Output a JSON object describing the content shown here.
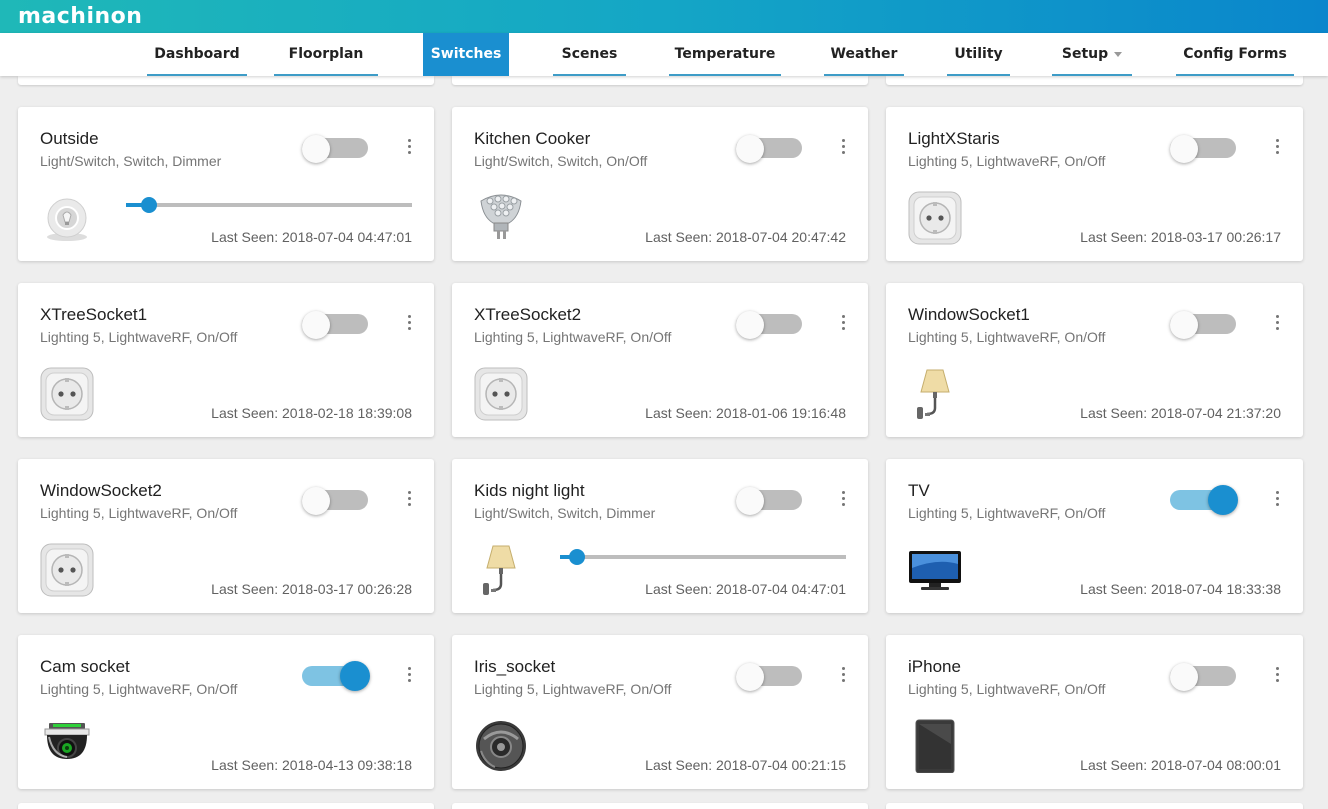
{
  "app": {
    "logo": "machinon"
  },
  "nav": [
    {
      "label": "Dashboard",
      "active": false
    },
    {
      "label": "Floorplan",
      "active": false
    },
    {
      "label": "Switches",
      "active": true
    },
    {
      "label": "Scenes",
      "active": false
    },
    {
      "label": "Temperature",
      "active": false
    },
    {
      "label": "Weather",
      "active": false
    },
    {
      "label": "Utility",
      "active": false
    },
    {
      "label": "Setup",
      "active": false,
      "dropdown": true
    },
    {
      "label": "Config Forms",
      "active": false
    }
  ],
  "devices": [
    {
      "name": "Outside",
      "type": "Light/Switch, Switch, Dimmer",
      "last_seen": "Last Seen: 2018-07-04 04:47:01",
      "on": false,
      "icon": "bulb-icon",
      "dimmer_level": 0.08
    },
    {
      "name": "Kitchen Cooker",
      "type": "Light/Switch, Switch, On/Off",
      "last_seen": "Last Seen: 2018-07-04 20:47:42",
      "on": false,
      "icon": "led-bulb-icon"
    },
    {
      "name": "LightXStaris",
      "type": "Lighting 5, LightwaveRF, On/Off",
      "last_seen": "Last Seen: 2018-03-17 00:26:17",
      "on": false,
      "icon": "socket-icon"
    },
    {
      "name": "XTreeSocket1",
      "type": "Lighting 5, LightwaveRF, On/Off",
      "last_seen": "Last Seen: 2018-02-18 18:39:08",
      "on": false,
      "icon": "socket-icon"
    },
    {
      "name": "XTreeSocket2",
      "type": "Lighting 5, LightwaveRF, On/Off",
      "last_seen": "Last Seen: 2018-01-06 19:16:48",
      "on": false,
      "icon": "socket-icon"
    },
    {
      "name": "WindowSocket1",
      "type": "Lighting 5, LightwaveRF, On/Off",
      "last_seen": "Last Seen: 2018-07-04 21:37:20",
      "on": false,
      "icon": "wall-lamp-icon"
    },
    {
      "name": "WindowSocket2",
      "type": "Lighting 5, LightwaveRF, On/Off",
      "last_seen": "Last Seen: 2018-03-17 00:26:28",
      "on": false,
      "icon": "socket-icon"
    },
    {
      "name": "Kids night light",
      "type": "Light/Switch, Switch, Dimmer",
      "last_seen": "Last Seen: 2018-07-04 04:47:01",
      "on": false,
      "icon": "wall-lamp-icon",
      "dimmer_level": 0.06
    },
    {
      "name": "TV",
      "type": "Lighting 5, LightwaveRF, On/Off",
      "last_seen": "Last Seen: 2018-07-04 18:33:38",
      "on": true,
      "icon": "tv-icon"
    },
    {
      "name": "Cam socket",
      "type": "Lighting 5, LightwaveRF, On/Off",
      "last_seen": "Last Seen: 2018-04-13 09:38:18",
      "on": true,
      "icon": "camera-icon"
    },
    {
      "name": "Iris_socket",
      "type": "Lighting 5, LightwaveRF, On/Off",
      "last_seen": "Last Seen: 2018-07-04 00:21:15",
      "on": false,
      "icon": "speaker-icon"
    },
    {
      "name": "iPhone",
      "type": "Lighting 5, LightwaveRF, On/Off",
      "last_seen": "Last Seen: 2018-07-04 08:00:01",
      "on": false,
      "icon": "tablet-icon"
    }
  ],
  "colors": {
    "accent": "#1a8fd0",
    "toggle_on_track": "#7ec3e3",
    "toggle_off_track": "#bdbdbd"
  }
}
